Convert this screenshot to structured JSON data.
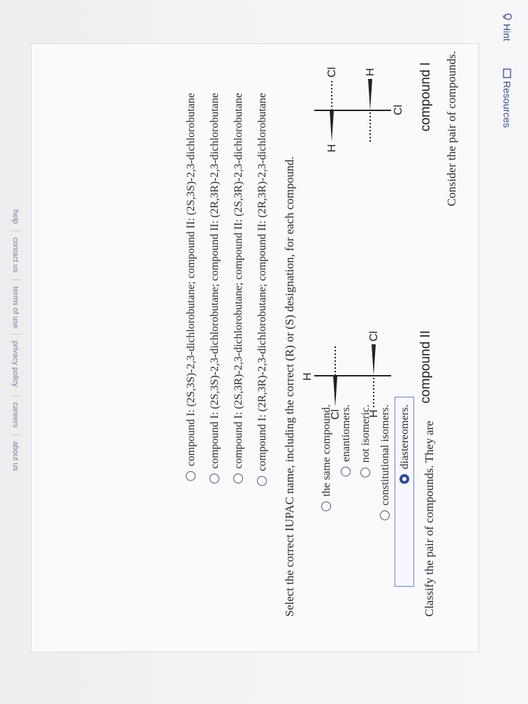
{
  "header": {
    "hint_label": "Hint",
    "resources_label": "Resources"
  },
  "question": {
    "intro": "Consider the pair of compounds.",
    "compound1_title": "compound I",
    "compound2_title": "compound II",
    "classify_prompt": "Classify the pair of compounds. They are",
    "classify_options": [
      {
        "label": "diastereomers.",
        "selected": true
      },
      {
        "label": "constitutional isomers.",
        "selected": false
      },
      {
        "label": "not isomeric.",
        "selected": false
      },
      {
        "label": "enantiomers.",
        "selected": false
      },
      {
        "label": "the same compound.",
        "selected": false
      }
    ],
    "iupac_prompt": "Select the correct IUPAC name, including the correct (R) or (S) designation, for each compound.",
    "iupac_options": [
      {
        "label": "compound I: (2R,3R)-2,3-dichlorobutane; compound II: (2R,3R)-2,3-dichlorobutane"
      },
      {
        "label": "compound I: (2S,3R)-2,3-dichlorobutane; compound II: (2S,3R)-2,3-dichlorobutane"
      },
      {
        "label": "compound I: (2S,3S)-2,3-dichlorobutane; compound II: (2R,3R)-2,3-dichlorobutane"
      },
      {
        "label": "compound I: (2S,3S)-2,3-dichlorobutane; compound II: (2S,3S)-2,3-dichlorobutane"
      }
    ]
  },
  "compound1": {
    "top_left": "H",
    "top_right": "Cl",
    "bottom_right": "H",
    "bottom_sub": "Cl"
  },
  "compound2": {
    "top_sub": "H",
    "top_left": "Cl",
    "bottom_left": "H",
    "bottom_right": "Cl"
  },
  "footer": {
    "links": [
      "about us",
      "careers",
      "privacy policy",
      "terms of use",
      "contact us",
      "help"
    ]
  },
  "colors": {
    "accent": "#2f4a9a",
    "text": "#2a2a33",
    "border": "#d9d9e2"
  }
}
